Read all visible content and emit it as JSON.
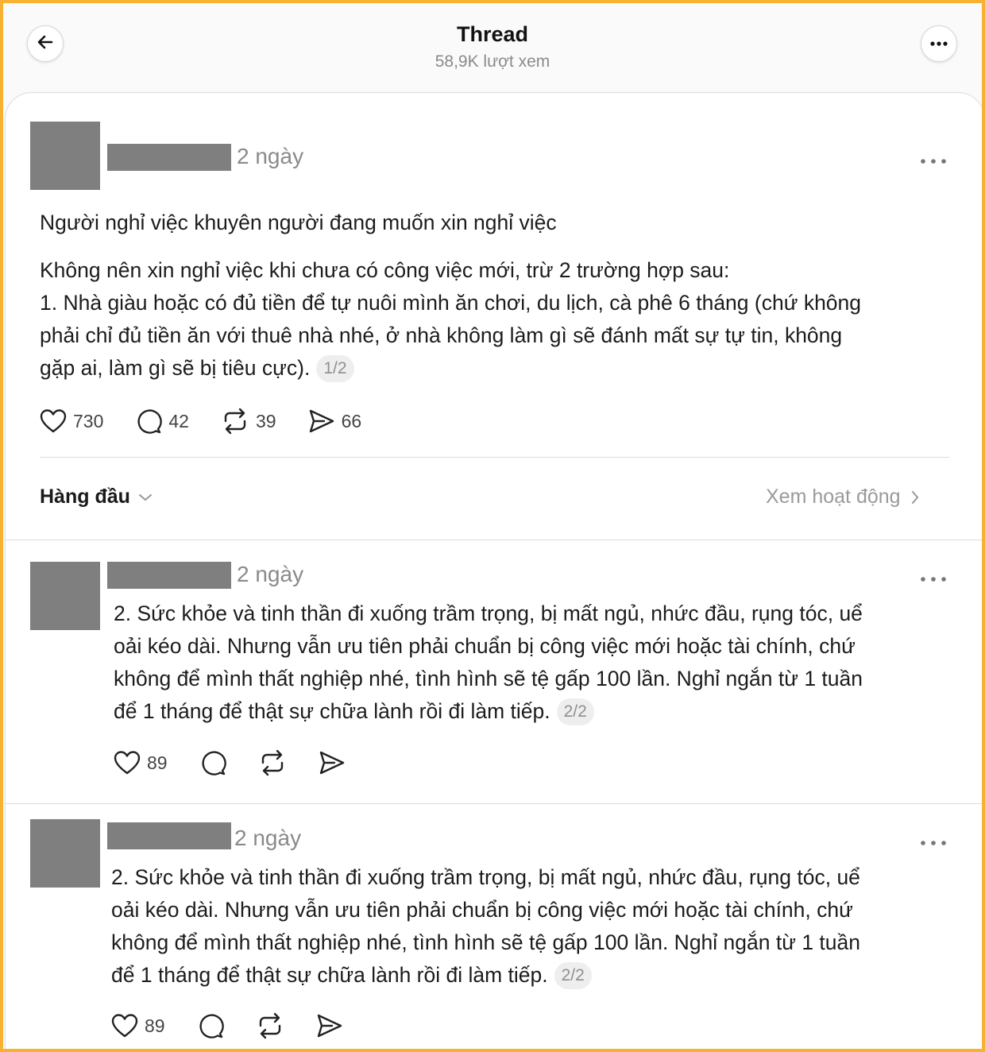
{
  "header": {
    "title": "Thread",
    "views": "58,9K lượt xem"
  },
  "main_post": {
    "time": "2 ngày",
    "line1": "Người nghỉ việc khuyên người đang muốn xin nghỉ việc",
    "line2": "Không nên xin nghỉ việc khi chưa có công việc mới, trừ 2 trường hợp sau:",
    "line3": "1. Nhà giàu hoặc có đủ tiền để tự nuôi mình ăn chơi, du lịch, cà phê 6 tháng (chứ không",
    "line4": "phải chỉ đủ tiền ăn với thuê nhà nhé, ở nhà không làm gì sẽ đánh mất sự tự tin, không",
    "line5": "gặp ai, làm gì sẽ bị tiêu cực).",
    "page": "1/2",
    "likes": "730",
    "replies": "42",
    "reposts": "39",
    "shares": "66"
  },
  "sort": {
    "label": "Hàng đầu",
    "activity": "Xem hoạt động"
  },
  "replies": [
    {
      "time": "2 ngày",
      "line1": "2. Sức khỏe và tinh thần đi xuống trầm trọng, bị mất ngủ, nhức đầu, rụng tóc, uể",
      "line2": "oải kéo dài. Nhưng vẫn ưu tiên phải chuẩn bị công việc mới hoặc tài chính, chứ",
      "line3": "không để mình thất nghiệp nhé, tình hình sẽ tệ gấp 100 lần. Nghỉ ngắn từ 1 tuần",
      "line4": "để 1 tháng để thật sự chữa lành rồi đi làm tiếp.",
      "page": "2/2",
      "likes": "89"
    },
    {
      "time": "2 ngày",
      "line1": "2. Sức khỏe và tinh thần đi xuống trầm trọng, bị mất ngủ, nhức đầu, rụng tóc, uể",
      "line2": "oải kéo dài. Nhưng vẫn ưu tiên phải chuẩn bị công việc mới hoặc tài chính, chứ",
      "line3": "không để mình thất nghiệp nhé, tình hình sẽ tệ gấp 100 lần. Nghỉ ngắn từ 1 tuần",
      "line4": "để 1 tháng để thật sự chữa lành rồi đi làm tiếp.",
      "page": "2/2",
      "likes": "89"
    }
  ],
  "colors": {
    "border": "#f7b233",
    "redaction": "#7f7f7f",
    "muted": "#8a8a8a"
  },
  "icons": [
    "back-arrow-icon",
    "more-icon",
    "heart-icon",
    "comment-icon",
    "repost-icon",
    "share-icon",
    "chevron-down-icon",
    "chevron-right-icon"
  ]
}
